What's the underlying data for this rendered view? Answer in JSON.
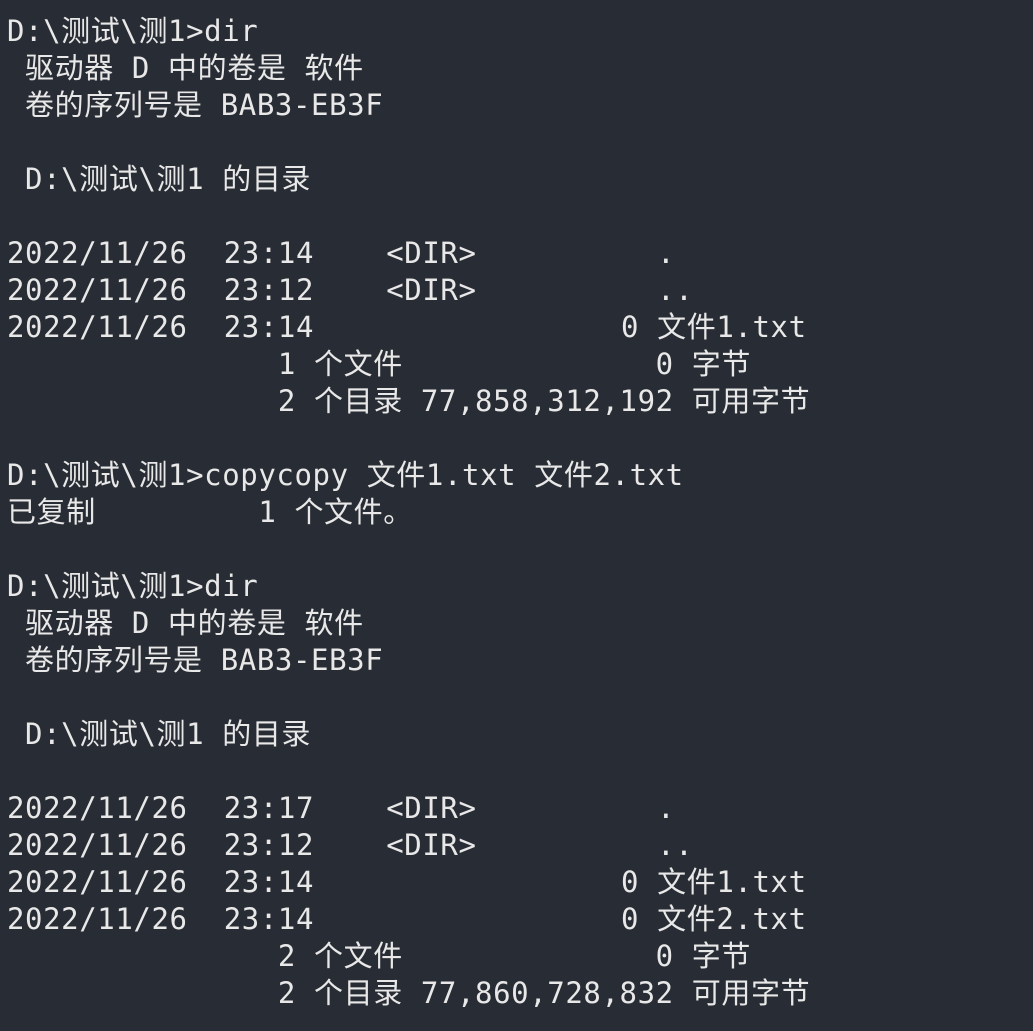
{
  "terminal": {
    "lines": [
      "D:\\测试\\测1>dir",
      " 驱动器 D 中的卷是 软件",
      " 卷的序列号是 BAB3-EB3F",
      "",
      " D:\\测试\\测1 的目录",
      "",
      "2022/11/26  23:14    <DIR>          .",
      "2022/11/26  23:12    <DIR>          ..",
      "2022/11/26  23:14                 0 文件1.txt",
      "               1 个文件              0 字节",
      "               2 个目录 77,858,312,192 可用字节",
      "",
      "D:\\测试\\测1>copycopy 文件1.txt 文件2.txt",
      "已复制         1 个文件。",
      "",
      "D:\\测试\\测1>dir",
      " 驱动器 D 中的卷是 软件",
      " 卷的序列号是 BAB3-EB3F",
      "",
      " D:\\测试\\测1 的目录",
      "",
      "2022/11/26  23:17    <DIR>          .",
      "2022/11/26  23:12    <DIR>          ..",
      "2022/11/26  23:14                 0 文件1.txt",
      "2022/11/26  23:14                 0 文件2.txt",
      "               2 个文件              0 字节",
      "               2 个目录 77,860,728,832 可用字节"
    ]
  }
}
